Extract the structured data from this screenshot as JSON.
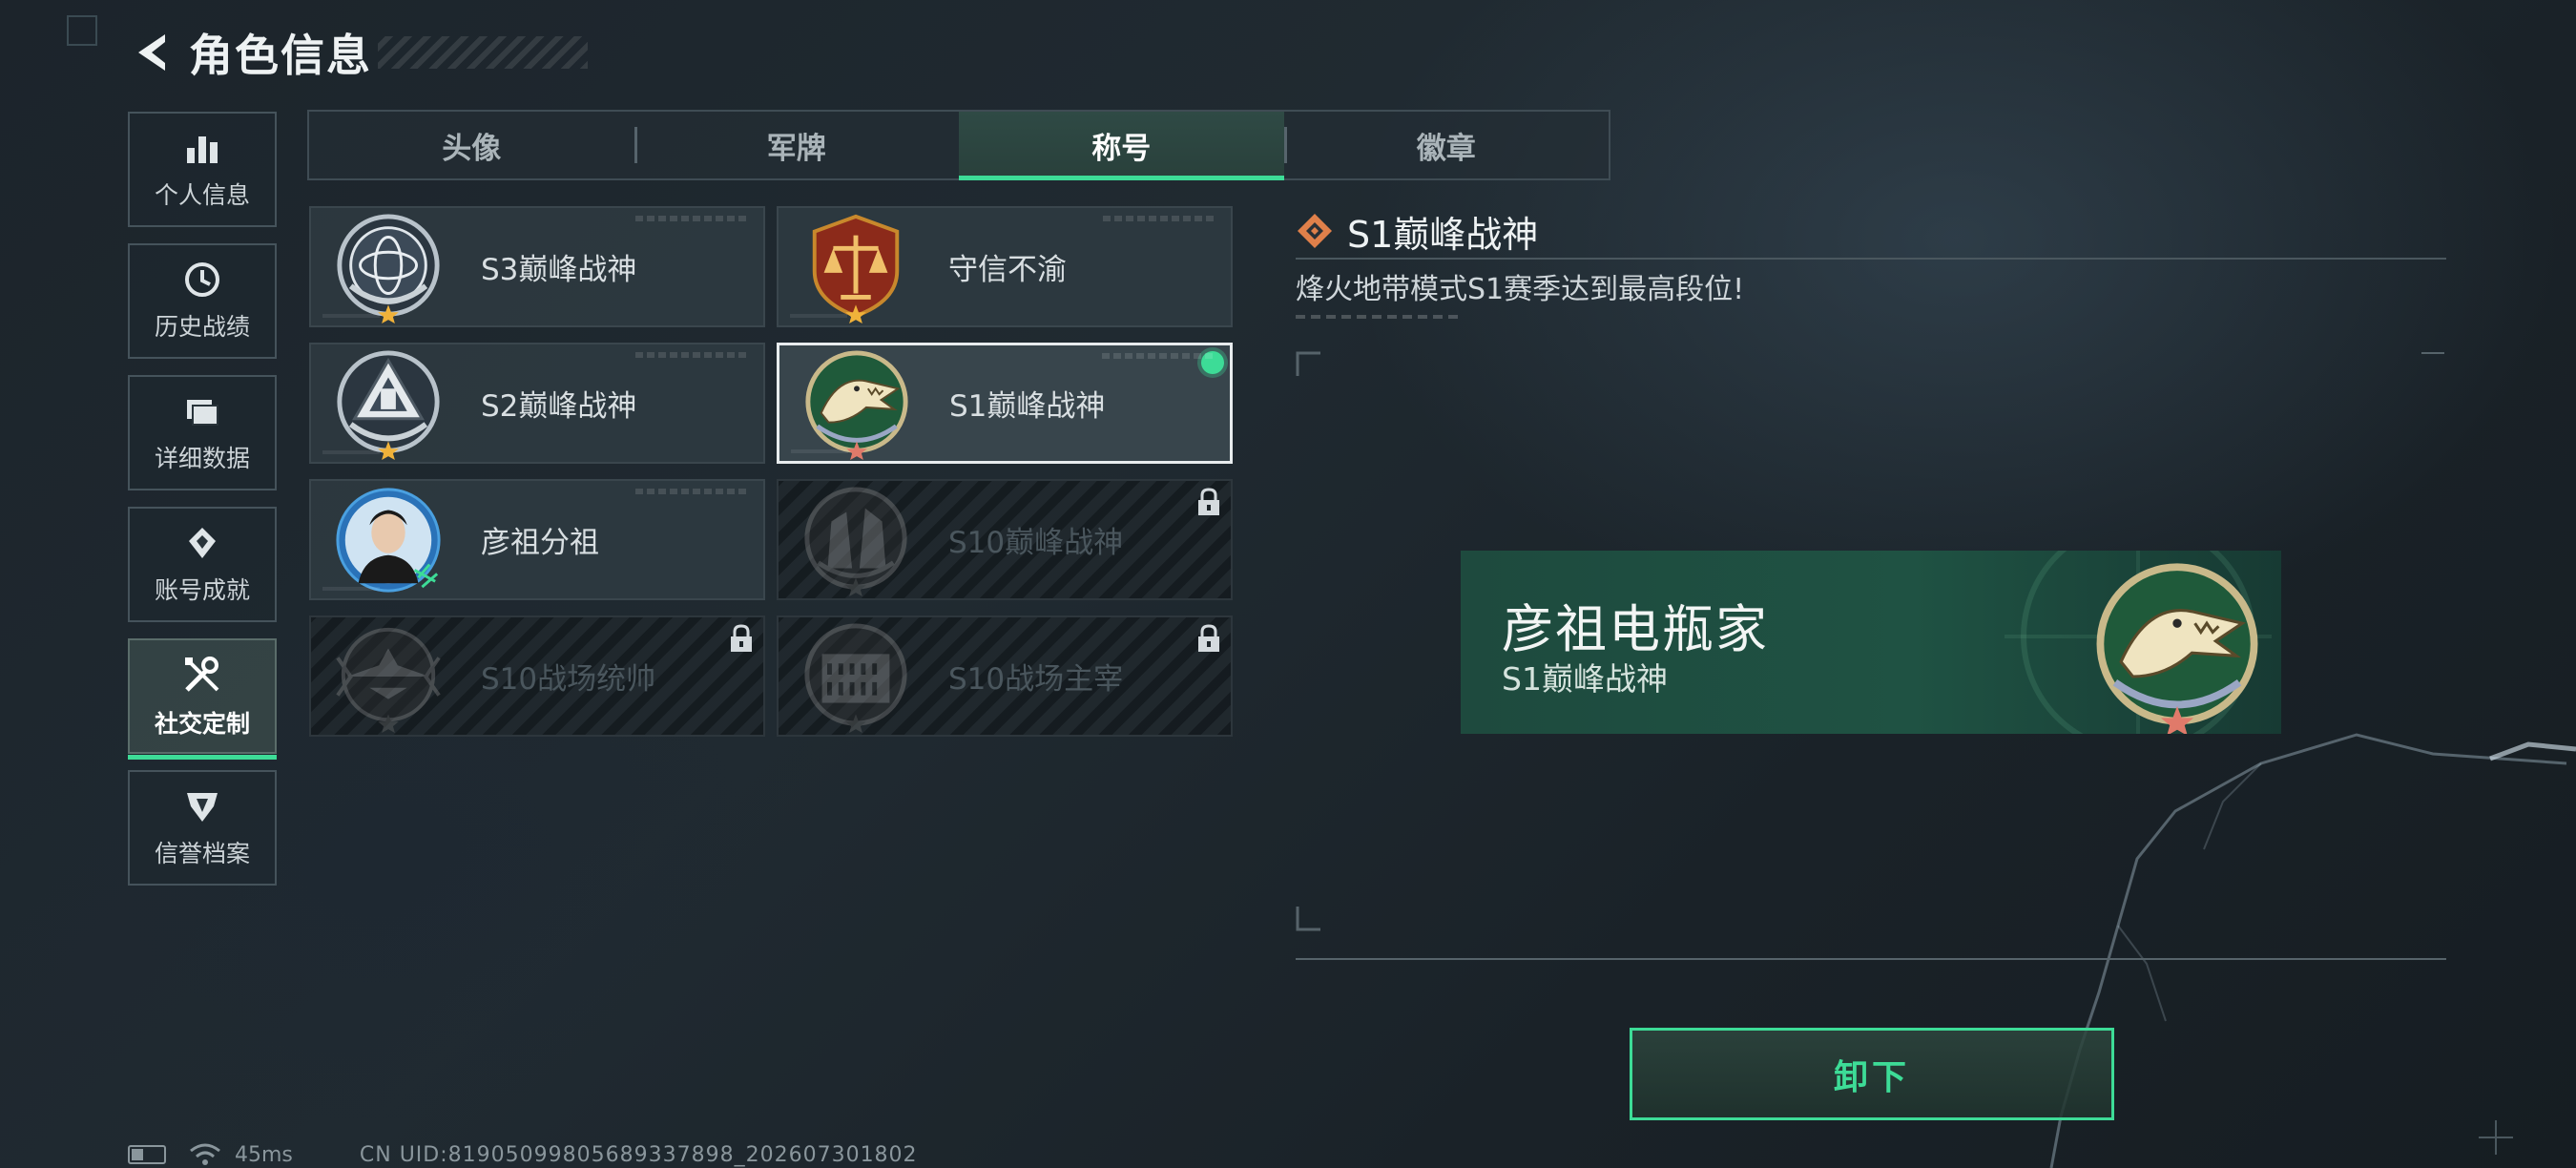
{
  "header": {
    "title": "角色信息"
  },
  "sidebar": {
    "items": [
      {
        "label": "个人信息",
        "icon": "bar-chart-icon"
      },
      {
        "label": "历史战绩",
        "icon": "clock-icon"
      },
      {
        "label": "详细数据",
        "icon": "folder-icon"
      },
      {
        "label": "账号成就",
        "icon": "achievement-icon"
      },
      {
        "label": "社交定制",
        "icon": "tools-icon",
        "active": true
      },
      {
        "label": "信誉档案",
        "icon": "credit-shield-icon"
      }
    ]
  },
  "tabs": [
    {
      "label": "头像"
    },
    {
      "label": "军牌"
    },
    {
      "label": "称号",
      "active": true
    },
    {
      "label": "徽章"
    }
  ],
  "titles": [
    {
      "name": "S3巅峰战神",
      "medal": "globe-medal",
      "state": "owned"
    },
    {
      "name": "守信不渝",
      "medal": "scales-medal",
      "state": "owned"
    },
    {
      "name": "S2巅峰战神",
      "medal": "tower-medal",
      "state": "owned"
    },
    {
      "name": "S1巅峰战神",
      "medal": "crocodile-medal",
      "state": "equipped"
    },
    {
      "name": "彦祖分祖",
      "medal": "portrait-medal",
      "state": "owned"
    },
    {
      "name": "S10巅峰战神",
      "medal": "building-medal",
      "state": "locked"
    },
    {
      "name": "S10战场统帅",
      "medal": "aircraft-medal",
      "state": "locked"
    },
    {
      "name": "S10战场主宰",
      "medal": "colosseum-medal",
      "state": "locked"
    }
  ],
  "detail": {
    "title": "S1巅峰战神",
    "description": "烽火地带模式S1赛季达到最高段位!",
    "preview": {
      "player_name": "彦祖电瓶家",
      "title": "S1巅峰战神"
    },
    "button_label": "卸下"
  },
  "status_bar": {
    "ping": "45ms",
    "uid": "CN UID:8190509980568933789​8_202607301802"
  },
  "colors": {
    "accent": "#3ddc97",
    "banner": "#1f5243",
    "background": "#1c242b"
  }
}
